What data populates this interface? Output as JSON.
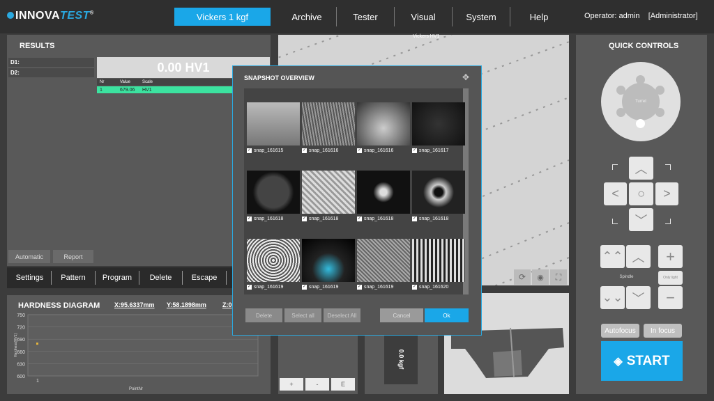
{
  "brand": {
    "logo_main": "INNOVA",
    "logo_accent": "TEST",
    "logo_reg": "®"
  },
  "nav": {
    "method": "Vickers 1 kgf",
    "archive": "Archive",
    "tester": "Tester",
    "visual": "Visual",
    "system": "System",
    "help": "Help"
  },
  "operator": {
    "text": "Operator: admin",
    "role": "[Administrator]"
  },
  "results": {
    "title": "RESULTS",
    "d1": "D1:",
    "d2": "D2:",
    "big_value": "0.00 HV1",
    "table_headers": [
      "Nr",
      "Value",
      "Scale"
    ],
    "rows": [
      {
        "nr": "1",
        "value": "679.06",
        "scale": "HV1"
      }
    ],
    "automatic": "Automatic",
    "report": "Report"
  },
  "menu": {
    "settings": "Settings",
    "pattern": "Pattern",
    "program": "Program",
    "delete": "Delete",
    "escape": "Escape"
  },
  "diagram": {
    "title": "HARDNESS DIAGRAM",
    "x": "X:95.6337mm",
    "y": "Y:58.1898mm",
    "z": "Z:0",
    "ylabel": "Hardness[HV1]",
    "xlabel": "PointNr"
  },
  "chart_data": {
    "type": "scatter",
    "x": [
      1
    ],
    "y": [
      679.06
    ],
    "ylim": [
      600,
      750
    ],
    "yticks": [
      "750",
      "720",
      "690",
      "660",
      "630",
      "600"
    ],
    "xticks": [
      "1"
    ],
    "xlabel": "PointNr",
    "ylabel": "Hardness[HV1]",
    "grid": true
  },
  "view": {
    "label": "Vickers HV1"
  },
  "load": {
    "text": "0.0 kgf"
  },
  "small_btns": [
    "+",
    "-",
    "E"
  ],
  "modal": {
    "title": "SNAPSHOT OVERVIEW",
    "snaps": [
      "snap_161615",
      "snap_161616",
      "snap_161616",
      "snap_161617",
      "snap_161618",
      "snap_161618",
      "snap_161618",
      "snap_161618",
      "snap_161619",
      "snap_161619",
      "snap_161619",
      "snap_161620"
    ],
    "delete": "Delete",
    "select_all": "Select all",
    "deselect_all": "Deselect All",
    "cancel": "Cancel",
    "ok": "Ok"
  },
  "quick": {
    "title": "QUICK CONTROLS",
    "turret": "Turret",
    "spindle": "Spindle",
    "only_light": "Only light",
    "autofocus": "Autofocus",
    "in_focus": "In focus",
    "start": "START"
  },
  "colors": {
    "accent": "#1aa7e8",
    "table_row": "#3ce3a0"
  }
}
